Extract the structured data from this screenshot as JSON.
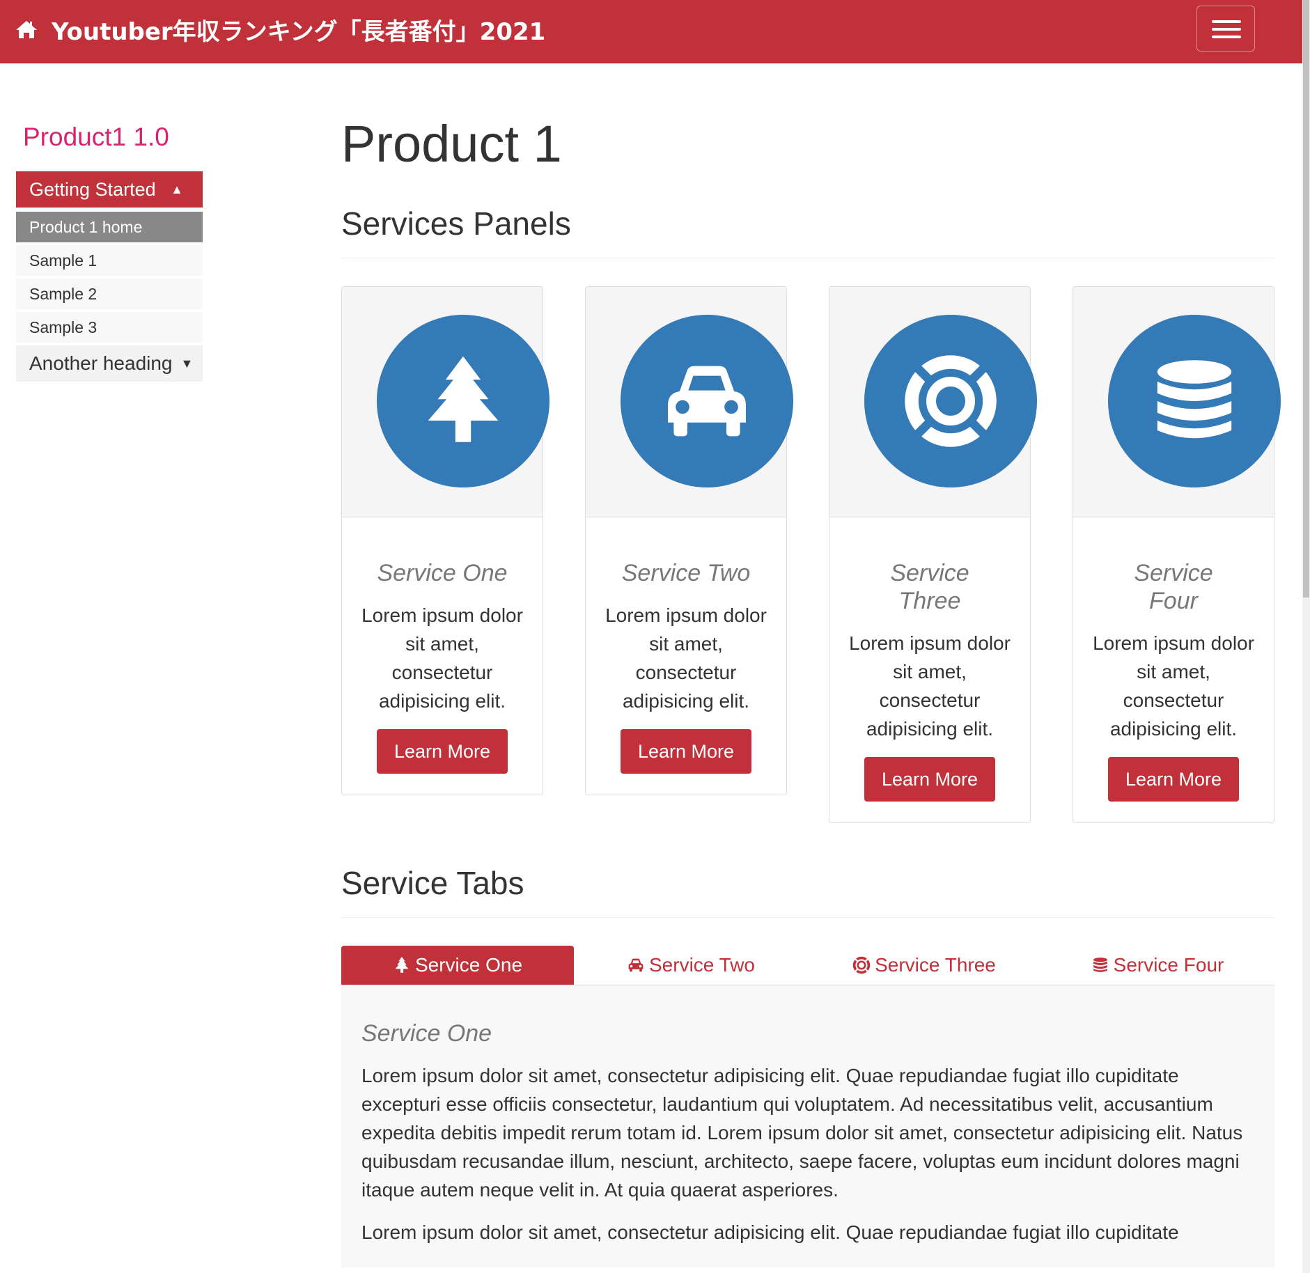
{
  "navbar": {
    "brand_title": "Youtuber年収ランキング「長者番付」2021",
    "home_icon": "home-icon",
    "toggle_icon": "hamburger-menu-icon"
  },
  "sidebar": {
    "title": "Product1 1.0",
    "heading": "Getting Started",
    "heading_caret": "▲",
    "items": [
      {
        "label": "Product 1 home"
      },
      {
        "label": "Sample 1"
      },
      {
        "label": "Sample 2"
      },
      {
        "label": "Sample 3"
      }
    ],
    "heading2": "Another heading",
    "heading2_caret": "▼"
  },
  "main": {
    "page_title": "Product 1",
    "panels_title": "Services Panels",
    "panels": [
      {
        "icon": "tree-icon",
        "title": "Service One",
        "text": "Lorem ipsum dolor sit amet, consectetur adipisicing elit.",
        "button": "Learn More"
      },
      {
        "icon": "car-icon",
        "title": "Service Two",
        "text": "Lorem ipsum dolor sit amet, consectetur adipisicing elit.",
        "button": "Learn More"
      },
      {
        "icon": "life-ring-icon",
        "title": "Service Three",
        "text": "Lorem ipsum dolor sit amet, consectetur adipisicing elit.",
        "button": "Learn More"
      },
      {
        "icon": "database-icon",
        "title": "Service Four",
        "text": "Lorem ipsum dolor sit amet, consectetur adipisicing elit.",
        "button": "Learn More"
      }
    ],
    "tabs_title": "Service Tabs",
    "tabs": [
      {
        "label": "Service One",
        "icon": "tree-icon"
      },
      {
        "label": "Service Two",
        "icon": "car-icon"
      },
      {
        "label": "Service Three",
        "icon": "life-ring-icon"
      },
      {
        "label": "Service Four",
        "icon": "database-icon"
      }
    ],
    "tab_pane": {
      "title": "Service One",
      "p1": "Lorem ipsum dolor sit amet, consectetur adipisicing elit. Quae repudiandae fugiat illo cupiditate excepturi esse officiis consectetur, laudantium qui voluptatem. Ad necessitatibus velit, accusantium expedita debitis impedit rerum totam id. Lorem ipsum dolor sit amet, consectetur adipisicing elit. Natus quibusdam recusandae illum, nesciunt, architecto, saepe facere, voluptas eum incidunt dolores magni itaque autem neque velit in. At quia quaerat asperiores.",
      "p2": "Lorem ipsum dolor sit amet, consectetur adipisicing elit. Quae repudiandae fugiat illo cupiditate"
    }
  },
  "colors": {
    "brand_red": "#c0313a",
    "icon_blue": "#337ab7",
    "sidebar_title_pink": "#d6246f"
  }
}
